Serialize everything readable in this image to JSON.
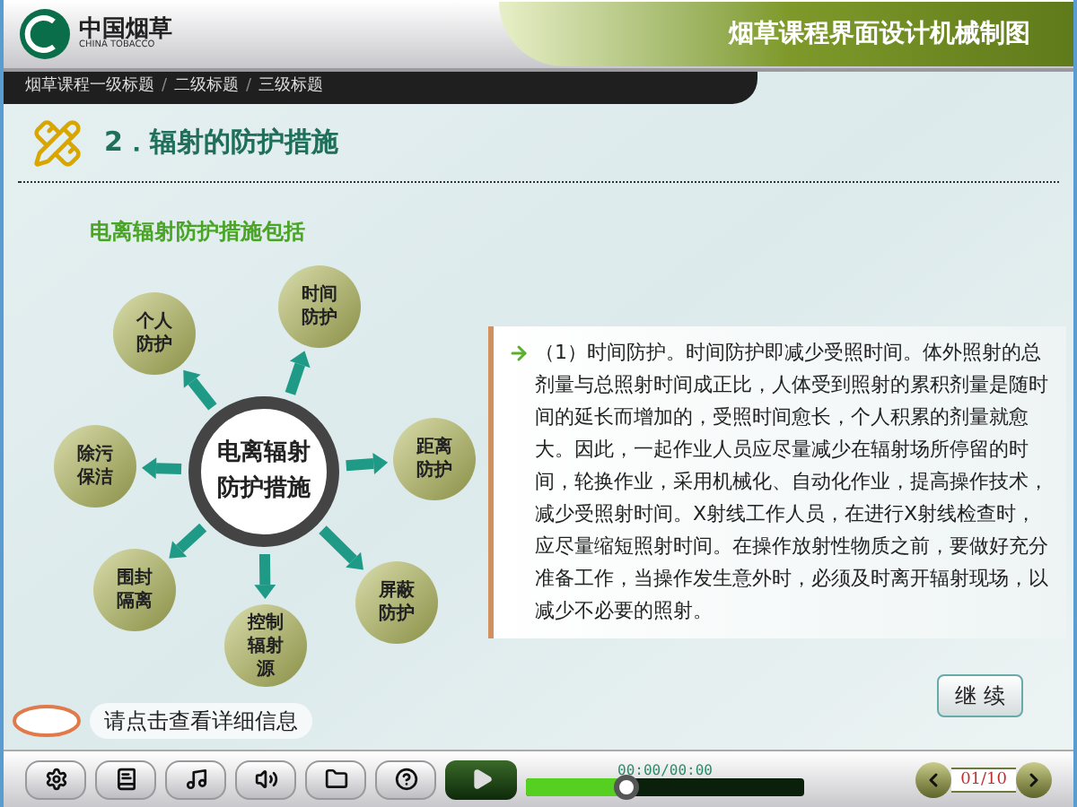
{
  "header": {
    "logo_text": "中国烟草",
    "logo_subtext": "CHINA TOBACCO",
    "course_title": "烟草课程界面设计机械制图"
  },
  "breadcrumb": {
    "separator": "/",
    "items": [
      "烟草课程一级标题",
      "二级标题",
      "三级标题"
    ]
  },
  "section_title": "2．辐射的防护措施",
  "diagram": {
    "title": "电离辐射防护措施包括",
    "center": "电离辐射防护措施",
    "nodes": [
      {
        "label": "时间防护"
      },
      {
        "label": "距离防护"
      },
      {
        "label": "屏蔽防护"
      },
      {
        "label": "控制辐射源"
      },
      {
        "label": "围封隔离"
      },
      {
        "label": "除污保洁"
      },
      {
        "label": "个人防护"
      }
    ]
  },
  "detail_text": "（1）时间防护。时间防护即减少受照时间。体外照射的总剂量与总照射时间成正比，人体受到照射的累积剂量是随时间的延长而增加的，受照时间愈长，个人积累的剂量就愈大。因此，一起作业人员应尽量减少在辐射场所停留的时间，轮换作业，采用机械化、自动化作业，提高操作技术，减少受照射时间。X射线工作人员，在进行X射线检查时，应尽量缩短照射时间。在操作放射性物质之前，要做好充分准备工作，当操作发生意外时，必须及时离开辐射现场，以减少不必要的照射。",
  "hint": "请点击查看详细信息",
  "continue_button": "继 续",
  "player": {
    "time": "00:00/00:00",
    "level": 0.36,
    "page": "01/10"
  }
}
